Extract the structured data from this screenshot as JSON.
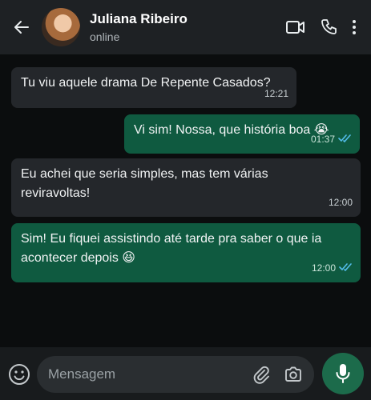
{
  "header": {
    "contact_name": "Juliana Ribeiro",
    "status": "online",
    "icons": [
      "back-arrow-icon",
      "video-call-icon",
      "phone-icon",
      "more-options-icon"
    ]
  },
  "messages": [
    {
      "direction": "incoming",
      "text": "Tu viu aquele drama De Repente Casados?",
      "time": "12:21"
    },
    {
      "direction": "outgoing",
      "text": "Vi sim! Nossa, que história boa 😭",
      "time": "01:37",
      "status": "read"
    },
    {
      "direction": "incoming",
      "text": "Eu achei que seria simples, mas tem várias reviravoltas!",
      "time": "12:00"
    },
    {
      "direction": "outgoing",
      "text": "Sim! Eu fiquei assistindo até tarde pra saber o que ia acontecer depois 😆",
      "time": "12:00",
      "status": "read"
    }
  ],
  "composer": {
    "placeholder": "Mensagem",
    "value": ""
  },
  "colors": {
    "incoming_bubble": "#24272b",
    "outgoing_bubble": "#0f5a40",
    "read_receipt": "#53bdeb",
    "mic_button": "#1c6b4b"
  }
}
